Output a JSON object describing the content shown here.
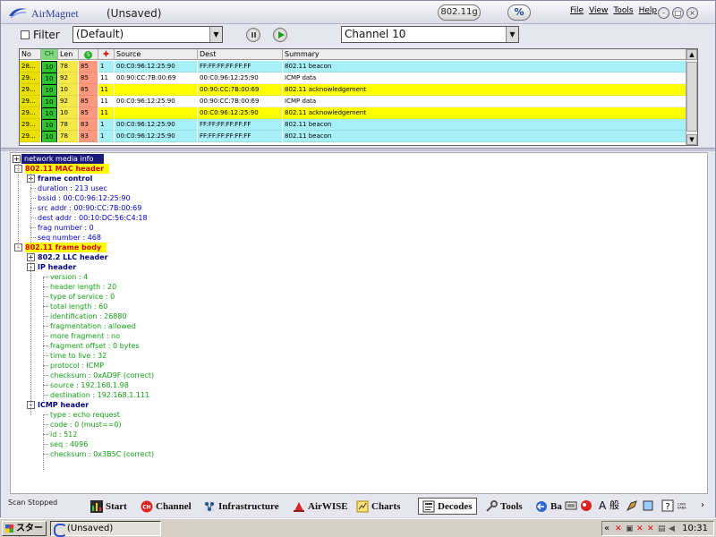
{
  "window": {
    "brand": "AirMagnet",
    "doc_title": "(Unsaved)",
    "band_badge": "802.11g",
    "pct_badge": "%",
    "menu": [
      "File",
      "View",
      "Tools",
      "Help"
    ]
  },
  "toolbar": {
    "filter_label": "Filter",
    "filter_value": "(Default)",
    "channel_value": "Channel 10"
  },
  "packet_table": {
    "columns": {
      "no": "No",
      "ch": "CH",
      "len": "Len",
      "signal": "S",
      "noise": "",
      "source": "Source",
      "dest": "Dest",
      "summary": "Summary"
    },
    "rows": [
      {
        "no": "28...",
        "ch": "10",
        "len": "78",
        "sig": "85",
        "noise": "1",
        "src": "00:C0:96:12:25:90",
        "dst": "FF:FF:FF:FF:FF:FF",
        "sum": "802.11 beacon",
        "color": "#a8f0f8"
      },
      {
        "no": "29...",
        "ch": "10",
        "len": "92",
        "sig": "85",
        "noise": "11",
        "src": "00:90:CC:7B:00:69",
        "dst": "00:C0:96:12:25:90",
        "sum": "ICMP data",
        "color": "#ffffff"
      },
      {
        "no": "29...",
        "ch": "10",
        "len": "10",
        "sig": "85",
        "noise": "11",
        "src": "",
        "dst": "00:90:CC:7B:00:69",
        "sum": "802.11 acknowledgement",
        "color": "#ffff00"
      },
      {
        "no": "29...",
        "ch": "10",
        "len": "92",
        "sig": "85",
        "noise": "11",
        "src": "00:C0:96:12:25:90",
        "dst": "00:90:CC:7B:00:69",
        "sum": "ICMP data",
        "color": "#ffffff"
      },
      {
        "no": "29...",
        "ch": "10",
        "len": "10",
        "sig": "85",
        "noise": "11",
        "src": "",
        "dst": "00:C0:96:12:25:90",
        "sum": "802.11 acknowledgement",
        "color": "#ffff00"
      },
      {
        "no": "29...",
        "ch": "10",
        "len": "78",
        "sig": "83",
        "noise": "1",
        "src": "00:C0:96:12:25:90",
        "dst": "FF:FF:FF:FF:FF:FF",
        "sum": "802.11 beacon",
        "color": "#a8f0f8"
      },
      {
        "no": "29...",
        "ch": "10",
        "len": "78",
        "sig": "83",
        "noise": "1",
        "src": "00:C0:96:12:25:90",
        "dst": "FF:FF:FF:FF:FF:FF",
        "sum": "802.11 beacon",
        "color": "#a8f0f8"
      }
    ]
  },
  "tree": {
    "root": "network media info",
    "rows": [
      {
        "level": 0,
        "exp": "-",
        "text": "802.11  MAC header",
        "style": "hl"
      },
      {
        "level": 1,
        "exp": "+",
        "text": "frame control",
        "style": "bold-blue"
      },
      {
        "level": 1,
        "exp": "",
        "text": "duration : 213 usec",
        "style": "blue"
      },
      {
        "level": 1,
        "exp": "",
        "text": "bssid : 00:C0:96:12:25:90",
        "style": "blue"
      },
      {
        "level": 1,
        "exp": "",
        "text": "src  addr : 00:90:CC:7B:00:69",
        "style": "blue"
      },
      {
        "level": 1,
        "exp": "",
        "text": "dest addr : 00:10:DC:56:C4:18",
        "style": "blue"
      },
      {
        "level": 1,
        "exp": "",
        "text": "frag number : 0",
        "style": "blue"
      },
      {
        "level": 1,
        "exp": "",
        "text": "seq number : 468",
        "style": "blue"
      },
      {
        "level": 0,
        "exp": "-",
        "text": "802.11  frame body",
        "style": "hl"
      },
      {
        "level": 1,
        "exp": "+",
        "text": "802.2  LLC header",
        "style": "bold-blue"
      },
      {
        "level": 1,
        "exp": "-",
        "text": "IP header",
        "style": "bold-blue"
      },
      {
        "level": 2,
        "exp": "",
        "text": "version : 4",
        "style": "green"
      },
      {
        "level": 2,
        "exp": "",
        "text": "header length : 20",
        "style": "green"
      },
      {
        "level": 2,
        "exp": "",
        "text": "type of service : 0",
        "style": "green"
      },
      {
        "level": 2,
        "exp": "",
        "text": "total length : 60",
        "style": "green"
      },
      {
        "level": 2,
        "exp": "",
        "text": "identification : 26880",
        "style": "green"
      },
      {
        "level": 2,
        "exp": "",
        "text": "fragmentation : allowed",
        "style": "green"
      },
      {
        "level": 2,
        "exp": "",
        "text": "more fragment : no",
        "style": "green"
      },
      {
        "level": 2,
        "exp": "",
        "text": "fragment offset : 0 bytes",
        "style": "green"
      },
      {
        "level": 2,
        "exp": "",
        "text": "time to live : 32",
        "style": "green"
      },
      {
        "level": 2,
        "exp": "",
        "text": "protocol : ICMP",
        "style": "green"
      },
      {
        "level": 2,
        "exp": "",
        "text": "checksum : 0xAD9F (correct)",
        "style": "green"
      },
      {
        "level": 2,
        "exp": "",
        "text": "source : 192.168.1.98",
        "style": "green"
      },
      {
        "level": 2,
        "exp": "",
        "text": "destination : 192.168.1.111",
        "style": "green"
      },
      {
        "level": 1,
        "exp": "-",
        "text": "ICMP header",
        "style": "bold-blue"
      },
      {
        "level": 2,
        "exp": "",
        "text": "type : echo request",
        "style": "green"
      },
      {
        "level": 2,
        "exp": "",
        "text": "code : 0 (must==0)",
        "style": "green"
      },
      {
        "level": 2,
        "exp": "",
        "text": "id : 512",
        "style": "green"
      },
      {
        "level": 2,
        "exp": "",
        "text": "seq : 4096",
        "style": "green"
      },
      {
        "level": 2,
        "exp": "",
        "text": "checksum : 0x3B5C (correct)",
        "style": "green"
      }
    ]
  },
  "bottombar": {
    "status": "Scan Stopped",
    "nav": [
      "Start",
      "Channel",
      "Infrastructure",
      "AirWISE",
      "Charts",
      "Decodes",
      "Tools",
      "Ba"
    ],
    "active": "Decodes"
  },
  "taskbar": {
    "start": "スタート",
    "task": "(Unsaved)",
    "time": "10:31"
  }
}
